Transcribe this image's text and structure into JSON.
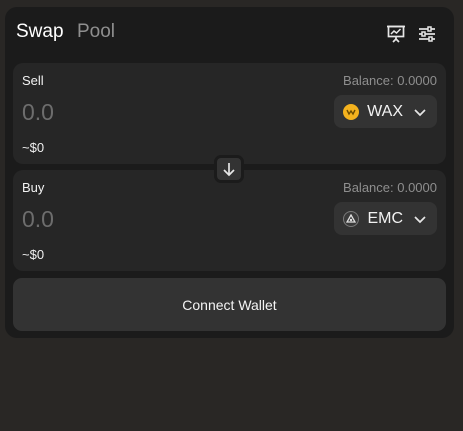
{
  "tabs": {
    "swap_label": "Swap",
    "pool_label": "Pool"
  },
  "header_icons": {
    "chart": "chart-icon",
    "settings": "settings-sliders-icon"
  },
  "sell": {
    "label": "Sell",
    "balance": "Balance: 0.0000",
    "amount_placeholder": "0.0",
    "usd_value": "~$0",
    "token": "WAX",
    "token_icon": "wax-token-icon",
    "token_icon_color": "#f4b21e"
  },
  "switch": {
    "icon": "arrow-down-icon"
  },
  "buy": {
    "label": "Buy",
    "balance": "Balance: 0.0000",
    "amount_placeholder": "0.0",
    "usd_value": "~$0",
    "token": "EMC",
    "token_icon": "emc-token-icon"
  },
  "connect_wallet_label": "Connect Wallet"
}
